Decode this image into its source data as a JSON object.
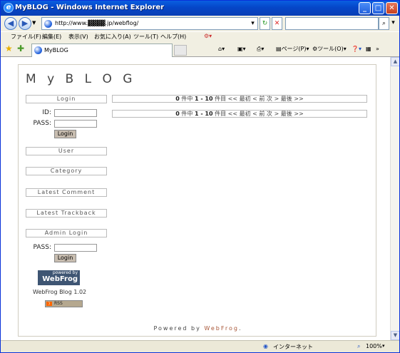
{
  "window": {
    "title": "MyBLOG - Windows Internet Explorer"
  },
  "address": {
    "url": "http://www.▓▓▓▓.jp/webflog/"
  },
  "menu": [
    "ファイル(F)",
    "編集(E)",
    "表示(V)",
    "お気に入り(A)",
    "ツール(T)",
    "ヘルプ(H)"
  ],
  "tab": {
    "label": "MyBLOG"
  },
  "toolbar": {
    "page_label": "ページ(P)",
    "tools_label": "ツール(O)"
  },
  "blog": {
    "title": "M y B L O G",
    "sidebar": {
      "login_header": "Login",
      "id_label": "ID:",
      "pass_label": "PASS:",
      "login_button": "Login",
      "user_header": "User",
      "category_header": "Category",
      "latest_comment_header": "Latest Comment",
      "latest_trackback_header": "Latest Trackback",
      "admin_login_header": "Admin Login",
      "admin_pass_label": "PASS:",
      "admin_login_button": "Login",
      "badge_small": "powered by",
      "badge_big": "WebFrog",
      "version": "WebFrog Blog 1.02",
      "rss_label": "RSS"
    },
    "pager": {
      "count": "0",
      "count_suffix": " 件中 ",
      "range": "1 - 10",
      "range_suffix": " 件目  ",
      "nav": "<< 最初  < 前  次 >  最後 >>"
    },
    "footer": {
      "powered_text": "Powered by ",
      "powered_link": "WebFrog",
      "suffix": "."
    }
  },
  "status": {
    "zone": "インターネット",
    "zoom": "100%"
  }
}
